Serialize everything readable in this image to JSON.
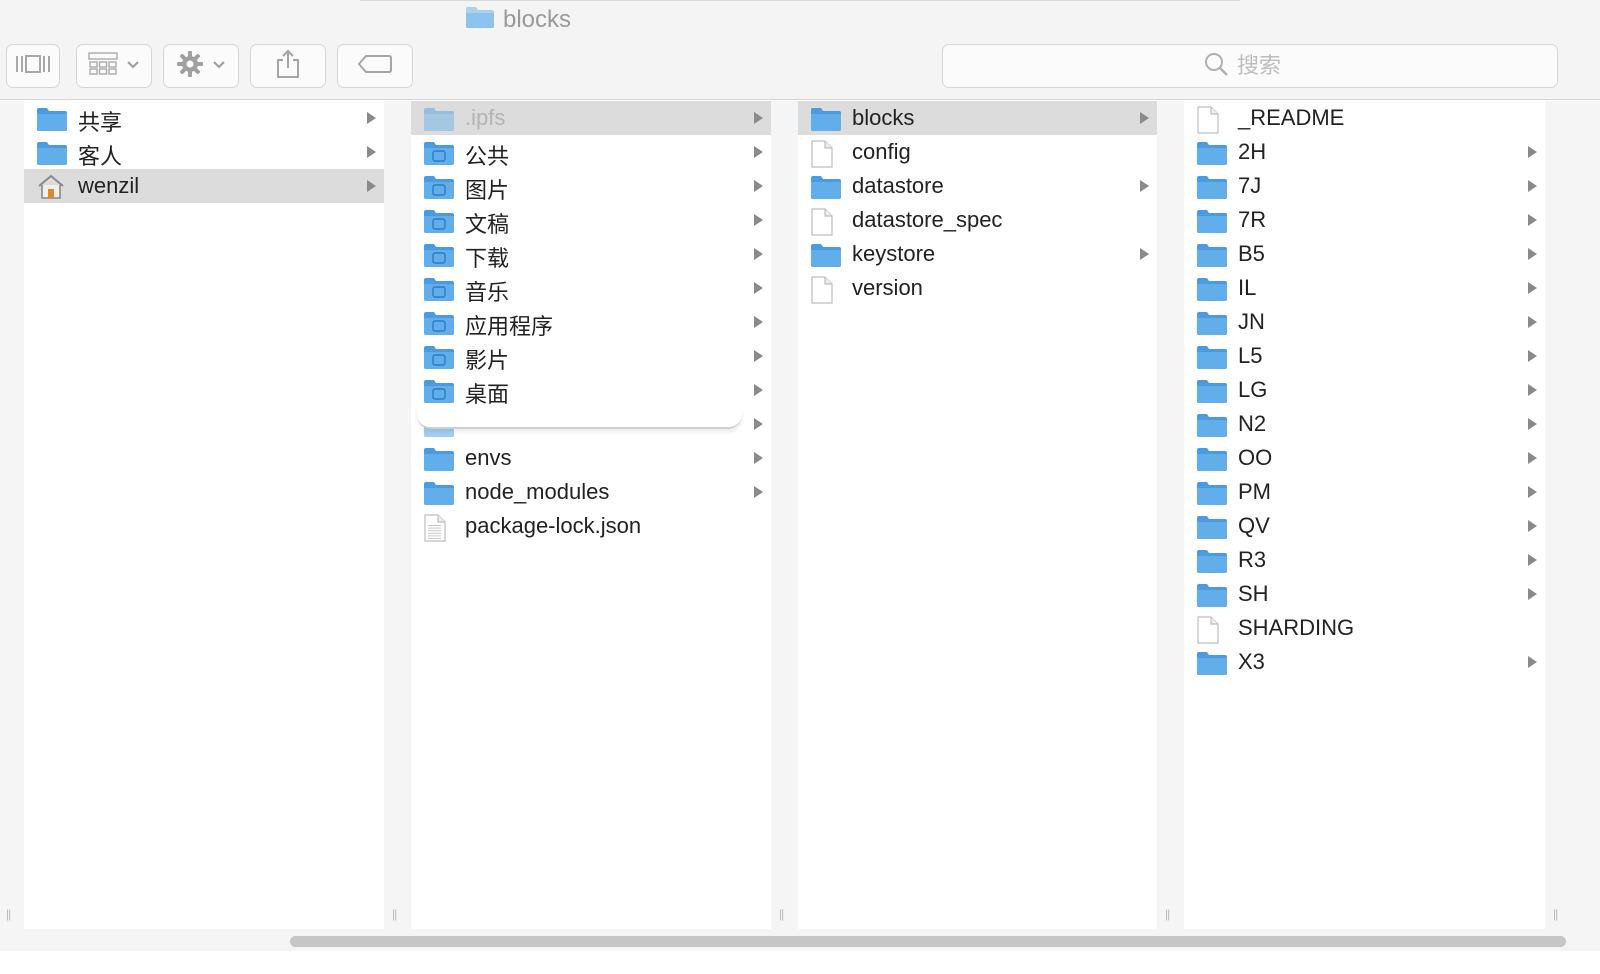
{
  "window": {
    "title": "blocks",
    "title_icon": "folder-icon"
  },
  "toolbar": {
    "view_icon": "column-view-icon",
    "group_icon": "grid-group-icon",
    "action_icon": "gear-icon",
    "share_icon": "share-icon",
    "tag_icon": "tag-icon",
    "search_placeholder": "搜索"
  },
  "colors": {
    "folder_blue": "#5aa9e6",
    "folder_light": "#8cc4ee",
    "selected_row": "#dcdcdc",
    "toolbar_bg": "#f4f4f4"
  },
  "columns": [
    {
      "items": [
        {
          "label": "共享",
          "icon": "folder-icon",
          "arrow": true
        },
        {
          "label": "客人",
          "icon": "folder-icon",
          "arrow": true
        },
        {
          "label": "wenzil",
          "icon": "home-icon",
          "arrow": true,
          "selected": true
        }
      ]
    },
    {
      "items": [
        {
          "label": ".ipfs",
          "icon": "folder-icon",
          "arrow": true,
          "selected": true,
          "dim": true
        },
        {
          "label": "公共",
          "icon": "public-folder-icon",
          "arrow": true
        },
        {
          "label": "图片",
          "icon": "pictures-folder-icon",
          "arrow": true
        },
        {
          "label": "文稿",
          "icon": "documents-folder-icon",
          "arrow": true
        },
        {
          "label": "下载",
          "icon": "downloads-folder-icon",
          "arrow": true
        },
        {
          "label": "音乐",
          "icon": "music-folder-icon",
          "arrow": true
        },
        {
          "label": "应用程序",
          "icon": "applications-folder-icon",
          "arrow": true
        },
        {
          "label": "影片",
          "icon": "movies-folder-icon",
          "arrow": true
        },
        {
          "label": "桌面",
          "icon": "desktop-folder-icon",
          "arrow": true
        },
        {
          "label": "",
          "icon": "folder-icon",
          "arrow": true,
          "obscured": true
        },
        {
          "label": "envs",
          "icon": "folder-icon",
          "arrow": true
        },
        {
          "label": "node_modules",
          "icon": "folder-icon",
          "arrow": true
        },
        {
          "label": "package-lock.json",
          "icon": "json-file-icon",
          "arrow": false
        }
      ]
    },
    {
      "items": [
        {
          "label": "blocks",
          "icon": "folder-icon",
          "arrow": true,
          "selected": true
        },
        {
          "label": "config",
          "icon": "file-icon",
          "arrow": false
        },
        {
          "label": "datastore",
          "icon": "folder-icon",
          "arrow": true
        },
        {
          "label": "datastore_spec",
          "icon": "file-icon",
          "arrow": false
        },
        {
          "label": "keystore",
          "icon": "folder-icon",
          "arrow": true
        },
        {
          "label": "version",
          "icon": "file-icon",
          "arrow": false
        }
      ]
    },
    {
      "items": [
        {
          "label": "_README",
          "icon": "file-icon",
          "arrow": false
        },
        {
          "label": "2H",
          "icon": "folder-icon",
          "arrow": true
        },
        {
          "label": "7J",
          "icon": "folder-icon",
          "arrow": true
        },
        {
          "label": "7R",
          "icon": "folder-icon",
          "arrow": true
        },
        {
          "label": "B5",
          "icon": "folder-icon",
          "arrow": true
        },
        {
          "label": "IL",
          "icon": "folder-icon",
          "arrow": true
        },
        {
          "label": "JN",
          "icon": "folder-icon",
          "arrow": true
        },
        {
          "label": "L5",
          "icon": "folder-icon",
          "arrow": true
        },
        {
          "label": "LG",
          "icon": "folder-icon",
          "arrow": true
        },
        {
          "label": "N2",
          "icon": "folder-icon",
          "arrow": true
        },
        {
          "label": "OO",
          "icon": "folder-icon",
          "arrow": true
        },
        {
          "label": "PM",
          "icon": "folder-icon",
          "arrow": true
        },
        {
          "label": "QV",
          "icon": "folder-icon",
          "arrow": true
        },
        {
          "label": "R3",
          "icon": "folder-icon",
          "arrow": true
        },
        {
          "label": "SH",
          "icon": "folder-icon",
          "arrow": true
        },
        {
          "label": "SHARDING",
          "icon": "file-icon",
          "arrow": false
        },
        {
          "label": "X3",
          "icon": "folder-icon",
          "arrow": true
        }
      ]
    }
  ]
}
